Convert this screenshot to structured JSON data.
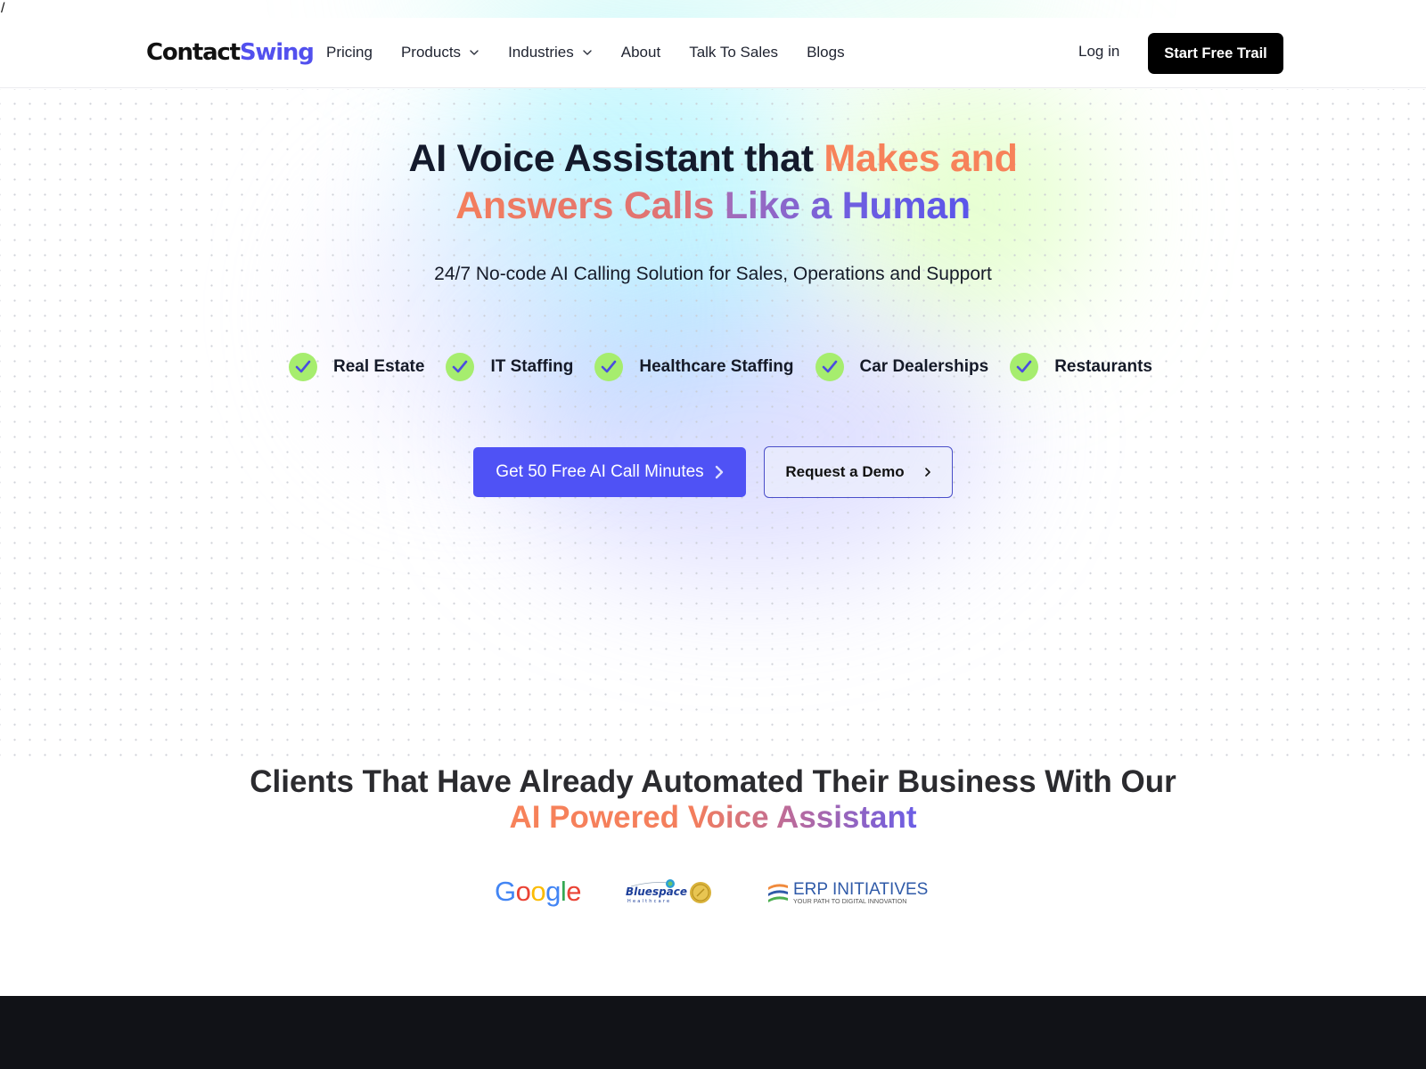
{
  "page": {
    "stray_text": "/"
  },
  "header": {
    "logo": {
      "part1": "Contact",
      "part2": "Swing"
    },
    "nav": [
      {
        "label": "Pricing",
        "has_dropdown": false
      },
      {
        "label": "Products",
        "has_dropdown": true
      },
      {
        "label": "Industries",
        "has_dropdown": true
      },
      {
        "label": "About",
        "has_dropdown": false
      },
      {
        "label": "Talk To Sales",
        "has_dropdown": false
      },
      {
        "label": "Blogs",
        "has_dropdown": false
      }
    ],
    "login_label": "Log in",
    "cta_label": "Start Free Trail"
  },
  "hero": {
    "headline": {
      "part1": "AI Voice Assistant that ",
      "part2": "Makes and",
      "part3": "Answers Calls ",
      "part4": "Like a Human"
    },
    "subheadline": "24/7 No-code AI Calling Solution for Sales, Operations and Support",
    "industries": [
      {
        "label": "Real Estate",
        "icon": "check-icon"
      },
      {
        "label": "IT Staffing",
        "icon": "check-icon"
      },
      {
        "label": "Healthcare Staffing",
        "icon": "check-icon"
      },
      {
        "label": "Car Dealerships",
        "icon": "check-icon"
      },
      {
        "label": "Restaurants",
        "icon": "check-icon"
      }
    ],
    "primary_button": {
      "label": "Get 50 Free AI Call Minutes",
      "icon": "chevron-right-icon"
    },
    "secondary_button": {
      "label": "Request a Demo",
      "icon": "chevron-right-icon"
    }
  },
  "clients": {
    "title": "Clients That Have Already Automated Their Business With Our",
    "subtitle": "AI Powered Voice Assistant",
    "logos": [
      {
        "name": "Google",
        "letters": [
          "G",
          "o",
          "o",
          "g",
          "l",
          "e"
        ]
      },
      {
        "name": "Bluespace Healthcare",
        "text": "Bluespace",
        "subtext": "Healthcare"
      },
      {
        "name": "ERP Initiatives",
        "text": "ERP INITIATIVES",
        "subtext": "YOUR PATH TO DIGITAL INNOVATION"
      }
    ]
  },
  "colors": {
    "brand_accent": "#4f52f5",
    "check_bg": "#a6ed6e",
    "headline_orange": "#f7825a",
    "headline_purple": "#5a55ea",
    "footer_bg": "#111217"
  }
}
